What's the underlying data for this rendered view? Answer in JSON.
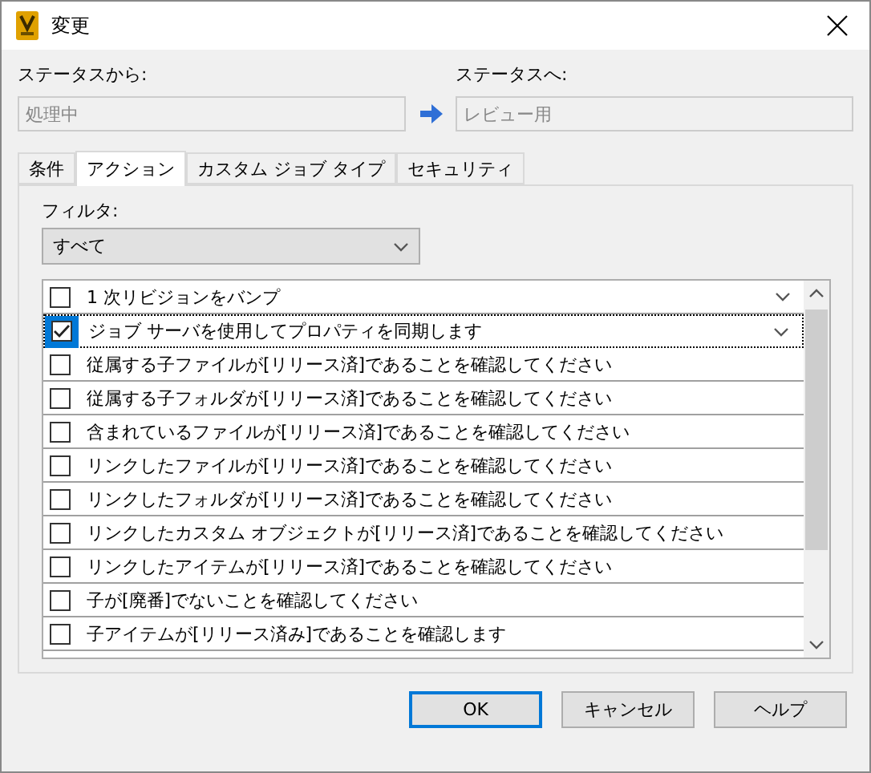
{
  "window": {
    "title": "変更"
  },
  "from": {
    "label": "ステータスから:",
    "value": "処理中"
  },
  "to": {
    "label": "ステータスへ:",
    "value": "レビュー用"
  },
  "tabs": [
    {
      "label": "条件",
      "selected": false
    },
    {
      "label": "アクション",
      "selected": true
    },
    {
      "label": "カスタム ジョブ タイプ",
      "selected": false
    },
    {
      "label": "セキュリティ",
      "selected": false
    }
  ],
  "filter": {
    "label": "フィルタ:",
    "value": "すべて"
  },
  "actions": [
    {
      "label": "1 次リビジョンをバンプ",
      "checked": false,
      "selected": false,
      "dropdown": true
    },
    {
      "label": "ジョブ サーバを使用してプロパティを同期します",
      "checked": true,
      "selected": true,
      "dropdown": true
    },
    {
      "label": "従属する子ファイルが[リリース済]であることを確認してください",
      "checked": false,
      "selected": false,
      "dropdown": false
    },
    {
      "label": "従属する子フォルダが[リリース済]であることを確認してください",
      "checked": false,
      "selected": false,
      "dropdown": false
    },
    {
      "label": "含まれているファイルが[リリース済]であることを確認してください",
      "checked": false,
      "selected": false,
      "dropdown": false
    },
    {
      "label": "リンクしたファイルが[リリース済]であることを確認してください",
      "checked": false,
      "selected": false,
      "dropdown": false
    },
    {
      "label": "リンクしたフォルダが[リリース済]であることを確認してください",
      "checked": false,
      "selected": false,
      "dropdown": false
    },
    {
      "label": "リンクしたカスタム オブジェクトが[リリース済]であることを確認してください",
      "checked": false,
      "selected": false,
      "dropdown": false
    },
    {
      "label": "リンクしたアイテムが[リリース済]であることを確認してください",
      "checked": false,
      "selected": false,
      "dropdown": false
    },
    {
      "label": "子が[廃番]でないことを確認してください",
      "checked": false,
      "selected": false,
      "dropdown": false
    },
    {
      "label": "子アイテムが[リリース済み]であることを確認します",
      "checked": false,
      "selected": false,
      "dropdown": false
    }
  ],
  "buttons": [
    {
      "label": "OK",
      "default": true
    },
    {
      "label": "キャンセル",
      "default": false
    },
    {
      "label": "ヘルプ",
      "default": false
    }
  ]
}
